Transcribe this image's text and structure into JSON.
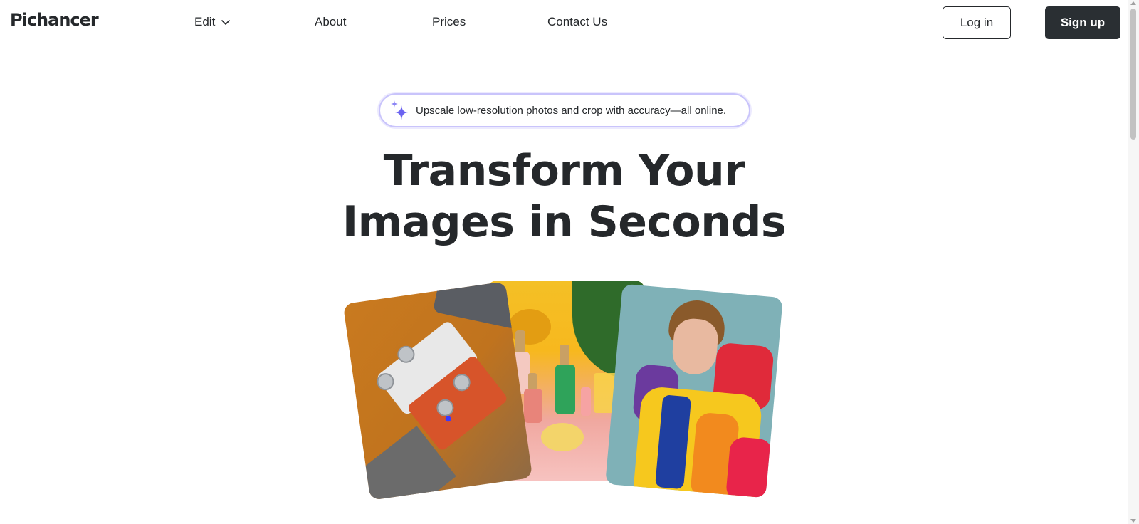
{
  "header": {
    "logo": "Pichancer",
    "nav": {
      "edit": "Edit",
      "about": "About",
      "prices": "Prices",
      "contact": "Contact Us"
    },
    "login_label": "Log in",
    "signup_label": "Sign up"
  },
  "hero": {
    "pill_text": "Upscale low-resolution photos and crop with accuracy—all online.",
    "headline_line1": "Transform Your",
    "headline_line2": "Images in Seconds"
  },
  "images": [
    {
      "subject": "guitar-effect-pedals"
    },
    {
      "subject": "cosmetic-bottles"
    },
    {
      "subject": "man-in-colorful-puffer-jacket"
    }
  ],
  "colors": {
    "text": "#25282b",
    "signup_bg": "#2a2f33",
    "pill_border": "#c9c4fb",
    "sparkle": "#6b63f0"
  },
  "icons": {
    "edit_dropdown": "chevron-down-icon",
    "pill": "sparkle-icon"
  }
}
